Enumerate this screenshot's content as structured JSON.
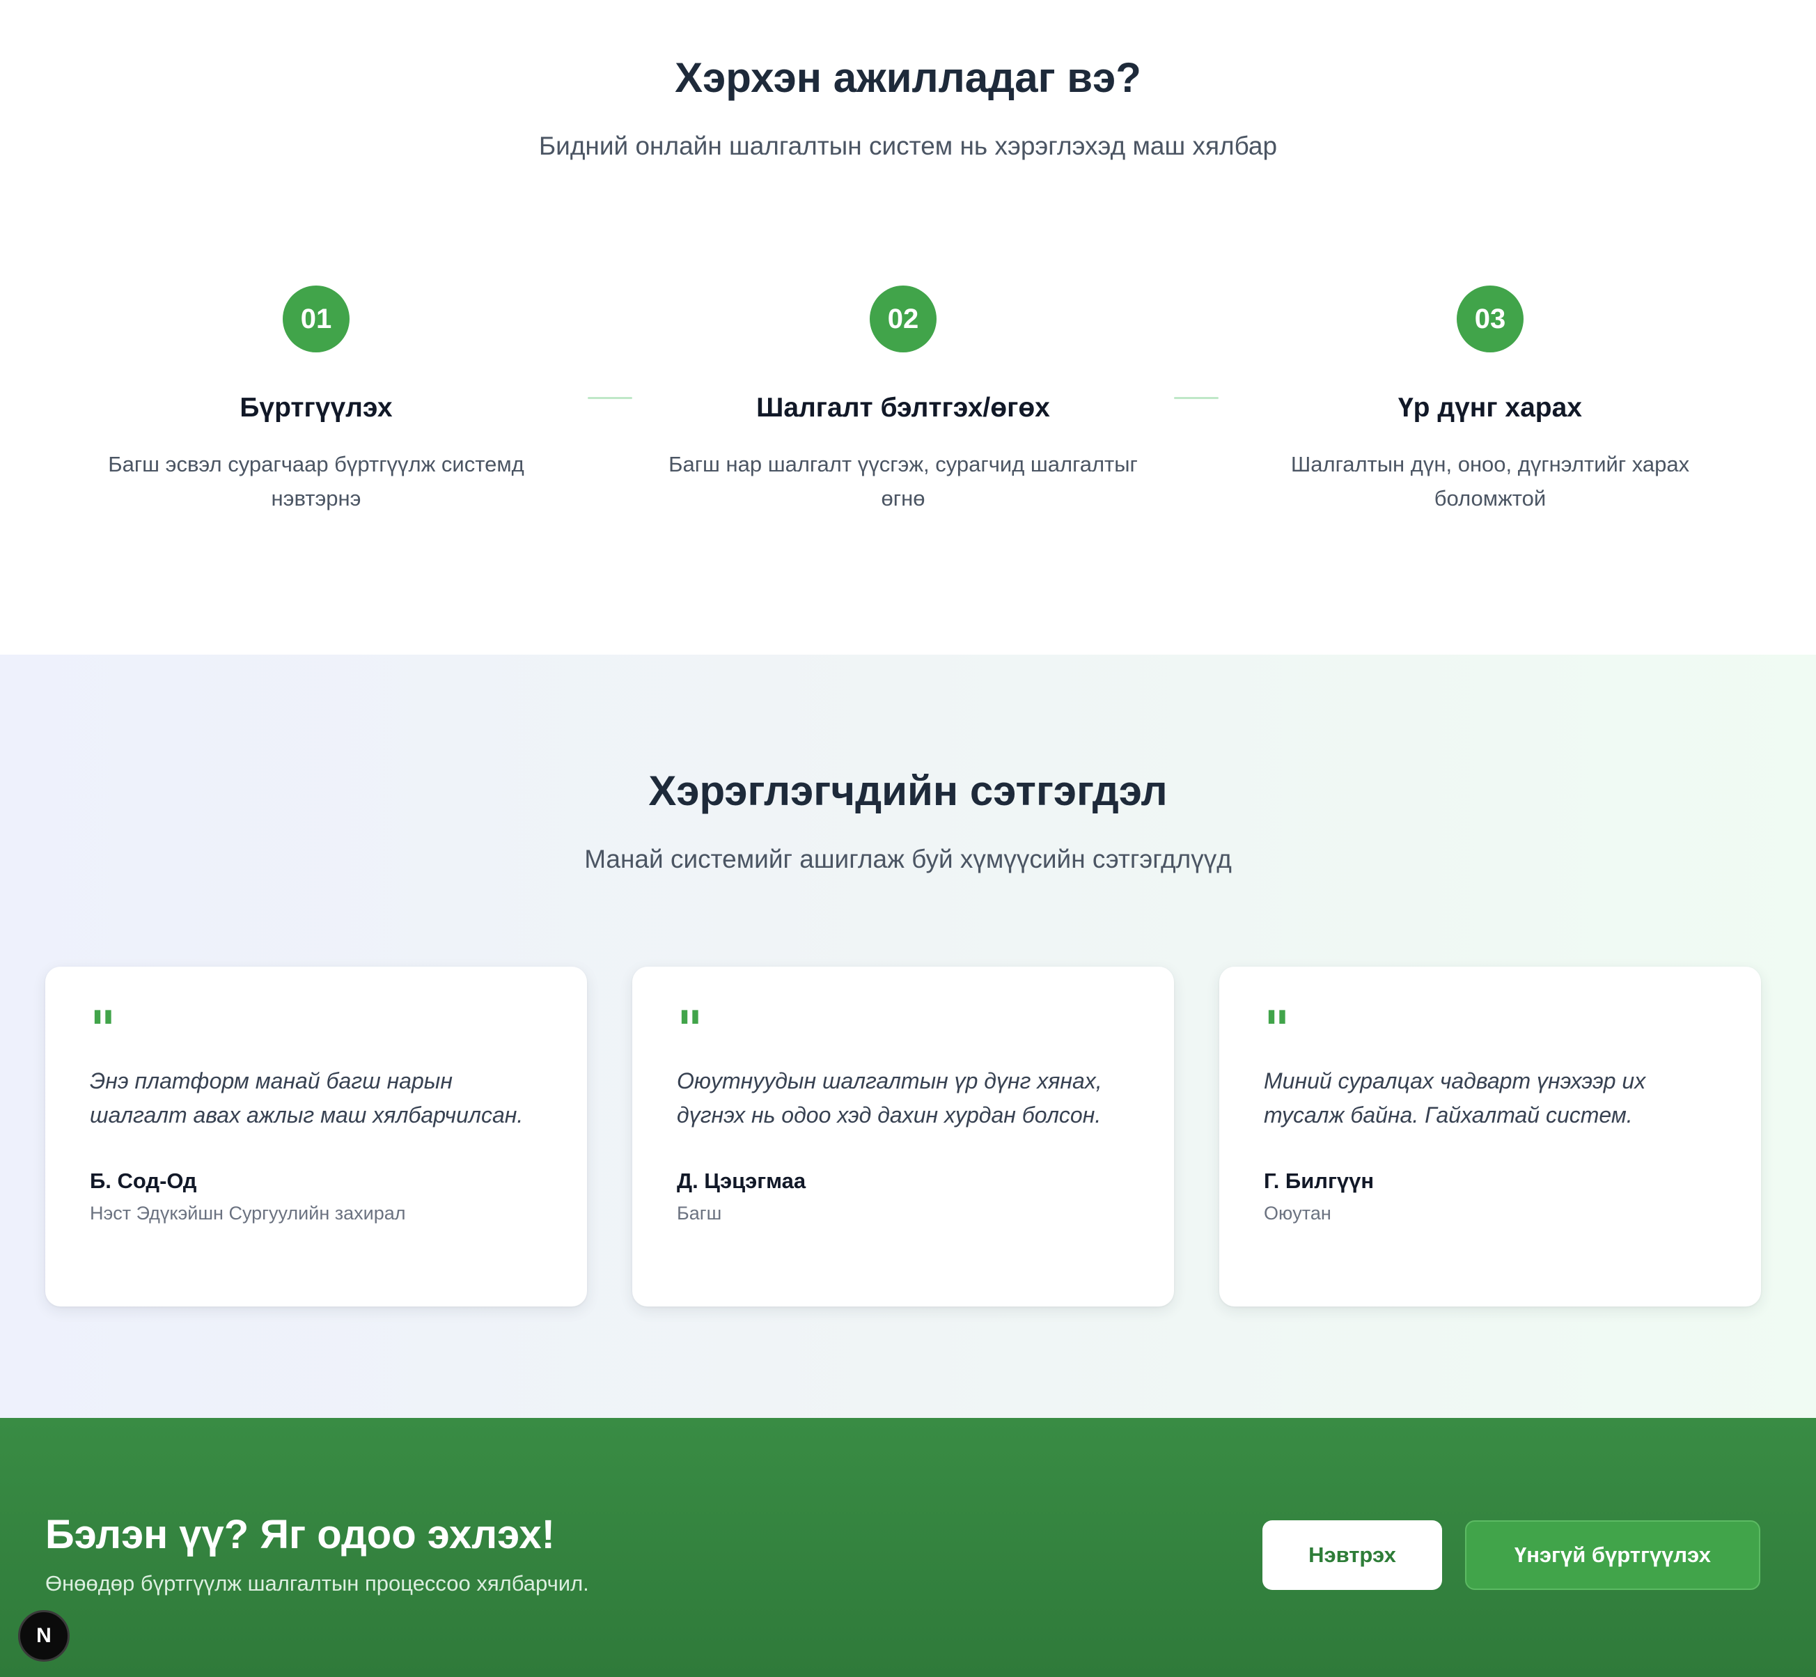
{
  "how_it_works": {
    "title": "Хэрхэн ажилладаг вэ?",
    "subtitle": "Бидний онлайн шалгалтын систем нь хэрэглэхэд маш хялбар",
    "steps": [
      {
        "number": "01",
        "title": "Бүртгүүлэх",
        "description": "Багш эсвэл сурагчаар бүртгүүлж системд нэвтэрнэ"
      },
      {
        "number": "02",
        "title": "Шалгалт бэлтгэх/өгөх",
        "description": "Багш нар шалгалт үүсгэж, сурагчид шалгалтыг өгнө"
      },
      {
        "number": "03",
        "title": "Үр дүнг харах",
        "description": "Шалгалтын дүн, оноо, дүгнэлтийг харах боломжтой"
      }
    ]
  },
  "testimonials": {
    "title": "Хэрэглэгчдийн сэтгэгдэл",
    "subtitle": "Манай системийг ашиглаж буй хүмүүсийн сэтгэгдлүүд",
    "quote_symbol": "\"",
    "items": [
      {
        "quote": "Энэ платформ манай багш нарын шалгалт авах ажлыг маш хялбарчилсан.",
        "name": "Б. Сод-Од",
        "role": "Нэст Эдүкэйшн Сургуулийн захирал"
      },
      {
        "quote": "Оюутнуудын шалгалтын үр дүнг хянах, дүгнэх нь одоо хэд дахин хурдан болсон.",
        "name": "Д. Цэцэгмаа",
        "role": "Багш"
      },
      {
        "quote": "Миний суралцах чадварт үнэхээр их тусалж байна. Гайхалтай систем.",
        "name": "Г. Билгүүн",
        "role": "Оюутан"
      }
    ]
  },
  "cta": {
    "title": "Бэлэн үү? Яг одоо эхлэх!",
    "subtitle": "Өнөөдөр бүртгүүлж шалгалтын процессоо хялбарчил.",
    "login_label": "Нэвтрэх",
    "register_label": "Үнэгүй бүртгүүлэх"
  },
  "badge": {
    "letter": "N"
  },
  "colors": {
    "accent_green": "#41a44a",
    "cta_background": "#398c44",
    "heading": "#1e2a3a"
  }
}
